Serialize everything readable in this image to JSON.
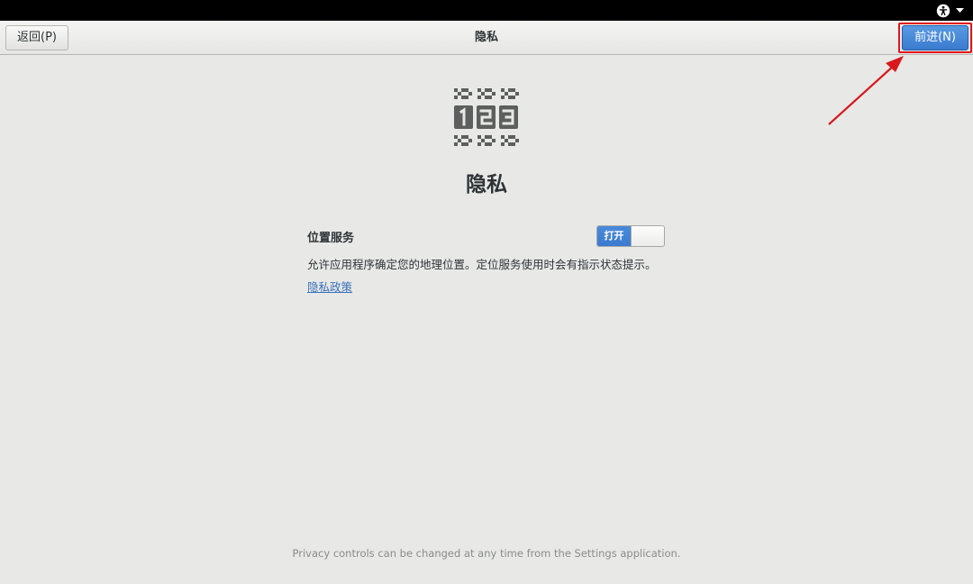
{
  "header": {
    "back_label": "返回(P)",
    "title": "隐私",
    "next_label": "前进(N)"
  },
  "page": {
    "title": "隐私",
    "location": {
      "label": "位置服务",
      "toggle_on_label": "打开",
      "toggle_state": "on",
      "description": "允许应用程序确定您的地理位置。定位服务使用时会有指示状态提示。"
    },
    "policy_link": "隐私政策",
    "footer": "Privacy controls can be changed at any time from the Settings application."
  },
  "icons": {
    "system_menu": [
      "accessibility-icon",
      "chevron-down-icon"
    ],
    "hero": "privacy-123-icon",
    "annotation": "red-arrow"
  },
  "colors": {
    "accent": "#3a7bd0",
    "highlight": "#e3161b",
    "link": "#3b73b9",
    "background": "#e8e8e7"
  }
}
